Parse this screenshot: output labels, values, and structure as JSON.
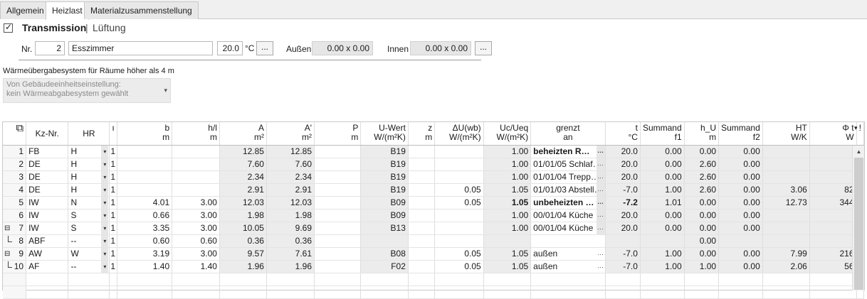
{
  "tabs": [
    "Allgemein",
    "Heizlast",
    "Materialzusammenstellung"
  ],
  "mode": {
    "transmission": "Transmission",
    "separator": "|",
    "lueftung": "Lüftung"
  },
  "room": {
    "nr_label": "Nr.",
    "nr_value": "2",
    "name": "Esszimmer",
    "temp": "20.0",
    "temp_unit": "°C",
    "ellipsis": "...",
    "aussen_label": "Außen",
    "aussen_value": "0.00 x 0.00",
    "innen_label": "Innen",
    "innen_value": "0.00 x 0.00"
  },
  "heat_transfer": {
    "label": "Wärmeübergabesystem für Räume höher als 4 m",
    "value_line1": "Von Gebäudeeinheitseinstellung:",
    "value_line2": "kein Wärmeabgabesystem gewählt"
  },
  "grid": {
    "headers": [
      {
        "l1": "",
        "l2": ""
      },
      {
        "l1": "Kz-Nr.",
        "l2": ""
      },
      {
        "l1": "HR",
        "l2": ""
      },
      {
        "l1": "ı",
        "l2": ""
      },
      {
        "l1": "b",
        "l2": "m"
      },
      {
        "l1": "h/l",
        "l2": "m"
      },
      {
        "l1": "A",
        "l2": "m²"
      },
      {
        "l1": "A'",
        "l2": "m²"
      },
      {
        "l1": "P",
        "l2": "m"
      },
      {
        "l1": "U-Wert",
        "l2": "W/(m²K)"
      },
      {
        "l1": "z",
        "l2": "m"
      },
      {
        "l1": "ΔU(wb)",
        "l2": "W/(m²K)"
      },
      {
        "l1": "Uc/Ueq",
        "l2": "W/(m²K)"
      },
      {
        "l1": "grenzt",
        "l2": "an"
      },
      {
        "l1": "t",
        "l2": "°C"
      },
      {
        "l1": "Summand",
        "l2": "f1"
      },
      {
        "l1": "h_U",
        "l2": "m"
      },
      {
        "l1": "Summand",
        "l2": "f2"
      },
      {
        "l1": "HT",
        "l2": "W/K"
      },
      {
        "l1": "Φ t",
        "l2": "W"
      },
      {
        "l1": "!",
        "l2": ""
      }
    ],
    "rows": [
      [
        "1",
        "FB",
        "H",
        "1",
        "",
        "",
        "12.85",
        "12.85",
        "",
        "B19",
        "",
        "",
        "1.00",
        "beheizten R…",
        "20.0",
        "0.00",
        "0.00",
        "0.00",
        "",
        "",
        ""
      ],
      [
        "2",
        "DE",
        "H",
        "1",
        "",
        "",
        "7.60",
        "7.60",
        "",
        "B19",
        "",
        "",
        "1.00",
        "01/01/05 Schlaf…",
        "20.0",
        "0.00",
        "2.60",
        "0.00",
        "",
        "",
        ""
      ],
      [
        "3",
        "DE",
        "H",
        "1",
        "",
        "",
        "2.34",
        "2.34",
        "",
        "B19",
        "",
        "",
        "1.00",
        "01/01/04 Trepp…",
        "20.0",
        "0.00",
        "2.60",
        "0.00",
        "",
        "",
        ""
      ],
      [
        "4",
        "DE",
        "H",
        "1",
        "",
        "",
        "2.91",
        "2.91",
        "",
        "B19",
        "",
        "0.05",
        "1.05",
        "01/01/03 Abstell…",
        "-7.0",
        "1.00",
        "2.60",
        "0.00",
        "3.06",
        "82",
        ""
      ],
      [
        "5",
        "IW",
        "N",
        "1",
        "4.01",
        "3.00",
        "12.03",
        "12.03",
        "",
        "B09",
        "",
        "0.05",
        "1.05",
        "unbeheizten …",
        "-7.2",
        "1.01",
        "0.00",
        "0.00",
        "12.73",
        "344",
        ""
      ],
      [
        "6",
        "IW",
        "S",
        "1",
        "0.66",
        "3.00",
        "1.98",
        "1.98",
        "",
        "B09",
        "",
        "",
        "1.00",
        "00/01/04 Küche",
        "20.0",
        "0.00",
        "0.00",
        "0.00",
        "",
        "",
        ""
      ],
      [
        "7",
        "IW",
        "S",
        "1",
        "3.35",
        "3.00",
        "10.05",
        "9.69",
        "",
        "B13",
        "",
        "",
        "1.00",
        "00/01/04 Küche",
        "20.0",
        "0.00",
        "0.00",
        "0.00",
        "",
        "",
        ""
      ],
      [
        "8",
        "ABF",
        "--",
        "1",
        "0.60",
        "0.60",
        "0.36",
        "0.36",
        "",
        "",
        "",
        "",
        "",
        "",
        "",
        "",
        "0.00",
        "",
        "",
        "",
        ""
      ],
      [
        "9",
        "AW",
        "W",
        "1",
        "3.19",
        "3.00",
        "9.57",
        "7.61",
        "",
        "B08",
        "",
        "0.05",
        "1.05",
        "außen",
        "-7.0",
        "1.00",
        "0.00",
        "0.00",
        "7.99",
        "216",
        ""
      ],
      [
        "10",
        "AF",
        "--",
        "1",
        "1.40",
        "1.40",
        "1.96",
        "1.96",
        "",
        "F02",
        "",
        "0.05",
        "1.05",
        "außen",
        "-7.0",
        "1.00",
        "1.00",
        "0.00",
        "2.06",
        "56",
        ""
      ]
    ]
  }
}
